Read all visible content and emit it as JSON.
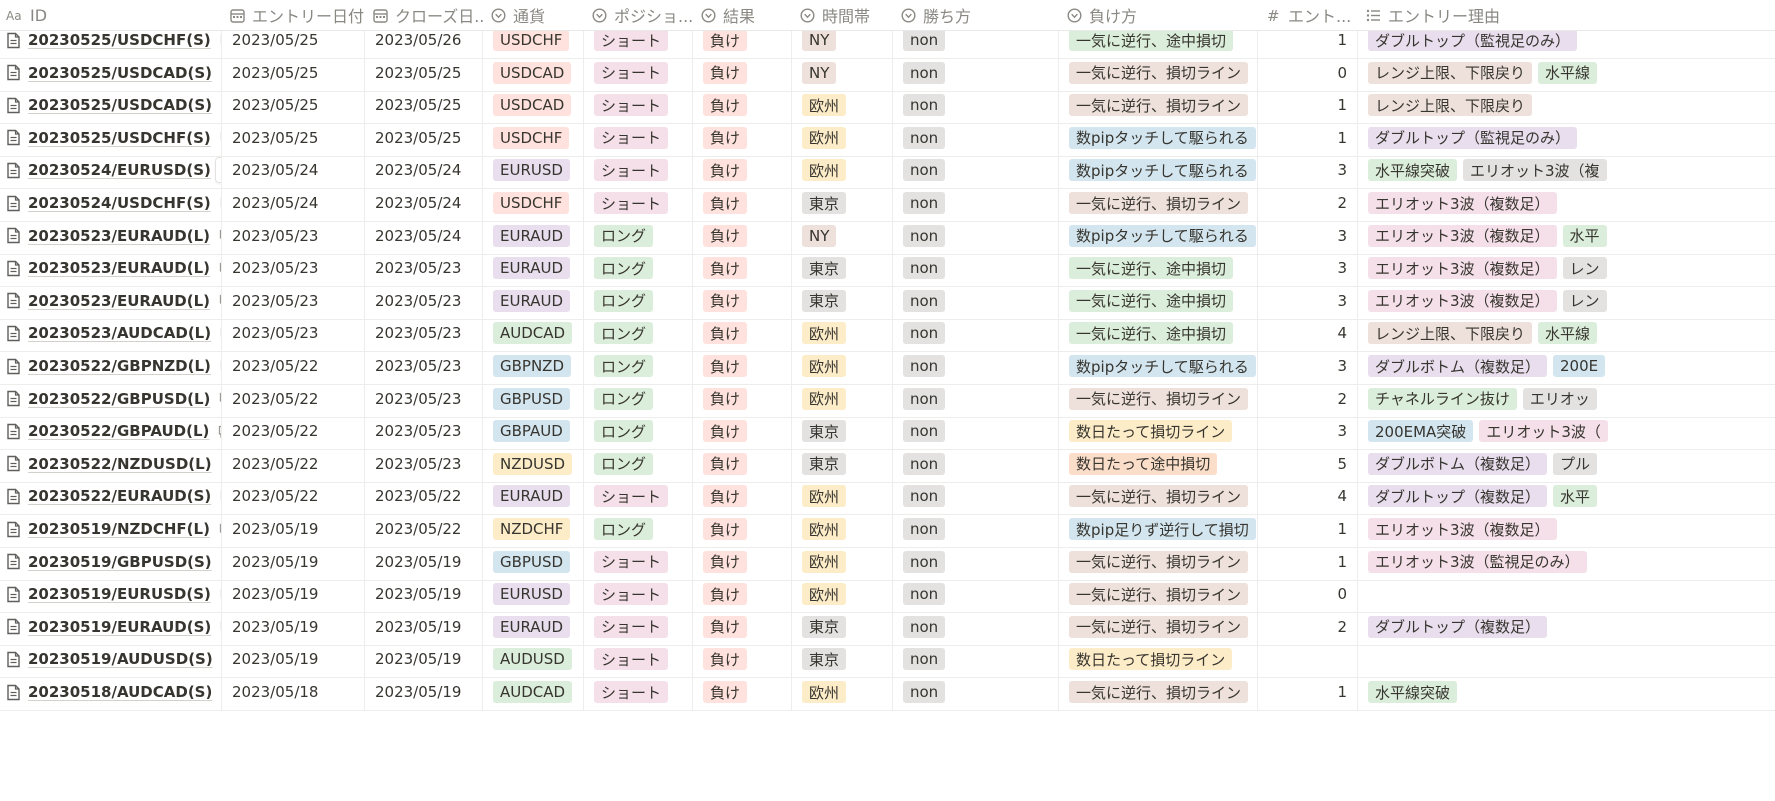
{
  "columns": [
    {
      "key": "id",
      "label": "ID",
      "icon": "title-icon"
    },
    {
      "key": "entry_date",
      "label": "エントリー日付",
      "icon": "calendar-icon"
    },
    {
      "key": "close_date",
      "label": "クローズ日...",
      "icon": "calendar-icon"
    },
    {
      "key": "currency",
      "label": "通貨",
      "icon": "select-icon"
    },
    {
      "key": "position",
      "label": "ポジショ...",
      "icon": "select-icon"
    },
    {
      "key": "result",
      "label": "結果",
      "icon": "select-icon"
    },
    {
      "key": "session",
      "label": "時間帯",
      "icon": "select-icon"
    },
    {
      "key": "win_method",
      "label": "勝ち方",
      "icon": "select-icon"
    },
    {
      "key": "loss_method",
      "label": "負け方",
      "icon": "select-icon"
    },
    {
      "key": "entries",
      "label": "エント...",
      "icon": "number-icon"
    },
    {
      "key": "reason",
      "label": "エントリー理由",
      "icon": "multiselect-icon"
    }
  ],
  "open_label": "開く",
  "colors": {
    "red": "#ffe2dd",
    "pink": "#f5e0e9",
    "purple": "#e8deee",
    "green": "#dbeddb",
    "gray": "#e3e2e0",
    "yellow": "#fdecc8",
    "orange": "#fadec9",
    "brown": "#eee0da",
    "blue": "#d3e5ef"
  },
  "option_colors": {
    "USDCHF": "red",
    "USDCAD": "red",
    "EURUSD": "purple",
    "EURAUD": "purple",
    "AUDCAD": "green",
    "AUDUSD": "green",
    "GBPNZD": "blue",
    "GBPUSD": "blue",
    "GBPAUD": "blue",
    "NZDUSD": "yellow",
    "NZDCHF": "yellow",
    "ショート": "pink",
    "ロング": "green",
    "負け": "red",
    "NY": "brown",
    "欧州": "yellow",
    "東京": "gray",
    "non": "gray",
    "一気に逆行、途中損切": "green",
    "一気に逆行、損切ライン": "brown",
    "数pipタッチして駆られる": "blue",
    "数日たって損切ライン": "yellow",
    "数日たって途中損切": "orange",
    "数pip足りず逆行して損切": "blue",
    "ダブルトップ（監視足のみ）": "purple",
    "レンジ上限、下限戻り": "brown",
    "水平線突破": "green",
    "エリオット3波（複数足）": "pink",
    "ダブルボトム（複数足）": "purple",
    "200EMA突破": "blue",
    "チャネルライン抜け": "green",
    "ダブルトップ（複数足）": "purple",
    "エリオット3波（監視足のみ）": "pink",
    "水平線": "green",
    "レンジ": "brown",
    "200E": "blue",
    "エリオット": "pink",
    "エリオット3波（": "pink",
    "プル": "gray",
    "水平": "green"
  },
  "rows": [
    {
      "id": "20230525/USDCHF(S)",
      "comments": "1",
      "entry_date": "2023/05/25",
      "close_date": "2023/05/26",
      "currency": "USDCHF",
      "position": "ショート",
      "result": "負け",
      "session": "NY",
      "win_method": "non",
      "loss_method": "一気に逆行、途中損切",
      "entries": "1",
      "reasons": [
        "ダブルトップ（監視足のみ）"
      ]
    },
    {
      "id": "20230525/USDCAD(S)",
      "comments": "1",
      "entry_date": "2023/05/25",
      "close_date": "2023/05/25",
      "currency": "USDCAD",
      "position": "ショート",
      "result": "負け",
      "session": "NY",
      "win_method": "non",
      "loss_method": "一気に逆行、損切ライン",
      "entries": "0",
      "reasons": [
        "レンジ上限、下限戻り",
        "水平線"
      ]
    },
    {
      "id": "20230525/USDCAD(S)",
      "comments": "1",
      "entry_date": "2023/05/25",
      "close_date": "2023/05/25",
      "currency": "USDCAD",
      "position": "ショート",
      "result": "負け",
      "session": "欧州",
      "win_method": "non",
      "loss_method": "一気に逆行、損切ライン",
      "entries": "1",
      "reasons": [
        "レンジ上限、下限戻り"
      ]
    },
    {
      "id": "20230525/USDCHF(S)",
      "comments": "2",
      "entry_date": "2023/05/25",
      "close_date": "2023/05/25",
      "currency": "USDCHF",
      "position": "ショート",
      "result": "負け",
      "session": "欧州",
      "win_method": "non",
      "loss_method": "数pipタッチして駆られる",
      "entries": "1",
      "reasons": [
        "ダブルトップ（監視足のみ）"
      ]
    },
    {
      "id": "20230524/EURUSD(S)",
      "comments": "",
      "show_open": true,
      "entry_date": "2023/05/24",
      "close_date": "2023/05/24",
      "currency": "EURUSD",
      "position": "ショート",
      "result": "負け",
      "session": "欧州",
      "win_method": "non",
      "loss_method": "数pipタッチして駆られる",
      "entries": "3",
      "reasons": [
        "水平線突破",
        "エリオット3波（複"
      ]
    },
    {
      "id": "20230524/USDCHF(S)",
      "comments": "1",
      "entry_date": "2023/05/24",
      "close_date": "2023/05/24",
      "currency": "USDCHF",
      "position": "ショート",
      "result": "負け",
      "session": "東京",
      "win_method": "non",
      "loss_method": "一気に逆行、損切ライン",
      "entries": "2",
      "reasons": [
        "エリオット3波（複数足）"
      ]
    },
    {
      "id": "20230523/EURAUD(L)",
      "comments": "1",
      "entry_date": "2023/05/23",
      "close_date": "2023/05/24",
      "currency": "EURAUD",
      "position": "ロング",
      "result": "負け",
      "session": "NY",
      "win_method": "non",
      "loss_method": "数pipタッチして駆られる",
      "entries": "3",
      "reasons": [
        "エリオット3波（複数足）",
        "水平"
      ]
    },
    {
      "id": "20230523/EURAUD(L)",
      "comments": "1",
      "entry_date": "2023/05/23",
      "close_date": "2023/05/23",
      "currency": "EURAUD",
      "position": "ロング",
      "result": "負け",
      "session": "東京",
      "win_method": "non",
      "loss_method": "一気に逆行、途中損切",
      "entries": "3",
      "reasons": [
        "エリオット3波（複数足）",
        "レン"
      ]
    },
    {
      "id": "20230523/EURAUD(L)",
      "comments": "1",
      "entry_date": "2023/05/23",
      "close_date": "2023/05/23",
      "currency": "EURAUD",
      "position": "ロング",
      "result": "負け",
      "session": "東京",
      "win_method": "non",
      "loss_method": "一気に逆行、途中損切",
      "entries": "3",
      "reasons": [
        "エリオット3波（複数足）",
        "レン"
      ]
    },
    {
      "id": "20230523/AUDCAD(L)",
      "comments": "1",
      "entry_date": "2023/05/23",
      "close_date": "2023/05/23",
      "currency": "AUDCAD",
      "position": "ロング",
      "result": "負け",
      "session": "欧州",
      "win_method": "non",
      "loss_method": "一気に逆行、途中損切",
      "entries": "4",
      "reasons": [
        "レンジ上限、下限戻り",
        "水平線"
      ]
    },
    {
      "id": "20230522/GBPNZD(L)",
      "comments": "1",
      "entry_date": "2023/05/22",
      "close_date": "2023/05/23",
      "currency": "GBPNZD",
      "position": "ロング",
      "result": "負け",
      "session": "欧州",
      "win_method": "non",
      "loss_method": "数pipタッチして駆られる",
      "entries": "3",
      "reasons": [
        "ダブルボトム（複数足）",
        "200E"
      ]
    },
    {
      "id": "20230522/GBPUSD(L)",
      "comments": "1",
      "entry_date": "2023/05/22",
      "close_date": "2023/05/23",
      "currency": "GBPUSD",
      "position": "ロング",
      "result": "負け",
      "session": "欧州",
      "win_method": "non",
      "loss_method": "一気に逆行、損切ライン",
      "entries": "2",
      "reasons": [
        "チャネルライン抜け",
        "エリオッ"
      ]
    },
    {
      "id": "20230522/GBPAUD(L)",
      "comments": "1",
      "entry_date": "2023/05/22",
      "close_date": "2023/05/23",
      "currency": "GBPAUD",
      "position": "ロング",
      "result": "負け",
      "session": "東京",
      "win_method": "non",
      "loss_method": "数日たって損切ライン",
      "entries": "3",
      "reasons": [
        "200EMA突破",
        "エリオット3波（"
      ]
    },
    {
      "id": "20230522/NZDUSD(L)",
      "comments": "1",
      "entry_date": "2023/05/22",
      "close_date": "2023/05/23",
      "currency": "NZDUSD",
      "position": "ロング",
      "result": "負け",
      "session": "東京",
      "win_method": "non",
      "loss_method": "数日たって途中損切",
      "entries": "5",
      "reasons": [
        "ダブルボトム（複数足）",
        "プル"
      ]
    },
    {
      "id": "20230522/EURAUD(S)",
      "comments": "1",
      "entry_date": "2023/05/22",
      "close_date": "2023/05/22",
      "currency": "EURAUD",
      "position": "ショート",
      "result": "負け",
      "session": "欧州",
      "win_method": "non",
      "loss_method": "一気に逆行、損切ライン",
      "entries": "4",
      "reasons": [
        "ダブルトップ（複数足）",
        "水平"
      ]
    },
    {
      "id": "20230519/NZDCHF(L)",
      "comments": "1",
      "entry_date": "2023/05/19",
      "close_date": "2023/05/22",
      "currency": "NZDCHF",
      "position": "ロング",
      "result": "負け",
      "session": "欧州",
      "win_method": "non",
      "loss_method": "数pip足りず逆行して損切",
      "entries": "1",
      "reasons": [
        "エリオット3波（複数足）"
      ]
    },
    {
      "id": "20230519/GBPUSD(S)",
      "comments": "1",
      "entry_date": "2023/05/19",
      "close_date": "2023/05/19",
      "currency": "GBPUSD",
      "position": "ショート",
      "result": "負け",
      "session": "欧州",
      "win_method": "non",
      "loss_method": "一気に逆行、損切ライン",
      "entries": "1",
      "reasons": [
        "エリオット3波（監視足のみ）"
      ]
    },
    {
      "id": "20230519/EURUSD(S)",
      "comments": "1",
      "entry_date": "2023/05/19",
      "close_date": "2023/05/19",
      "currency": "EURUSD",
      "position": "ショート",
      "result": "負け",
      "session": "欧州",
      "win_method": "non",
      "loss_method": "一気に逆行、損切ライン",
      "entries": "0",
      "reasons": []
    },
    {
      "id": "20230519/EURAUD(S)",
      "comments": "1",
      "entry_date": "2023/05/19",
      "close_date": "2023/05/19",
      "currency": "EURAUD",
      "position": "ショート",
      "result": "負け",
      "session": "東京",
      "win_method": "non",
      "loss_method": "一気に逆行、損切ライン",
      "entries": "2",
      "reasons": [
        "ダブルトップ（複数足）"
      ]
    },
    {
      "id": "20230519/AUDUSD(S)",
      "comments": "1",
      "entry_date": "2023/05/19",
      "close_date": "2023/05/19",
      "currency": "AUDUSD",
      "position": "ショート",
      "result": "負け",
      "session": "東京",
      "win_method": "non",
      "loss_method": "数日たって損切ライン",
      "entries": "",
      "reasons": []
    },
    {
      "id": "20230518/AUDCAD(S)",
      "comments": "2",
      "entry_date": "2023/05/18",
      "close_date": "2023/05/19",
      "currency": "AUDCAD",
      "position": "ショート",
      "result": "負け",
      "session": "欧州",
      "win_method": "non",
      "loss_method": "一気に逆行、損切ライン",
      "entries": "1",
      "reasons": [
        "水平線突破"
      ]
    }
  ]
}
